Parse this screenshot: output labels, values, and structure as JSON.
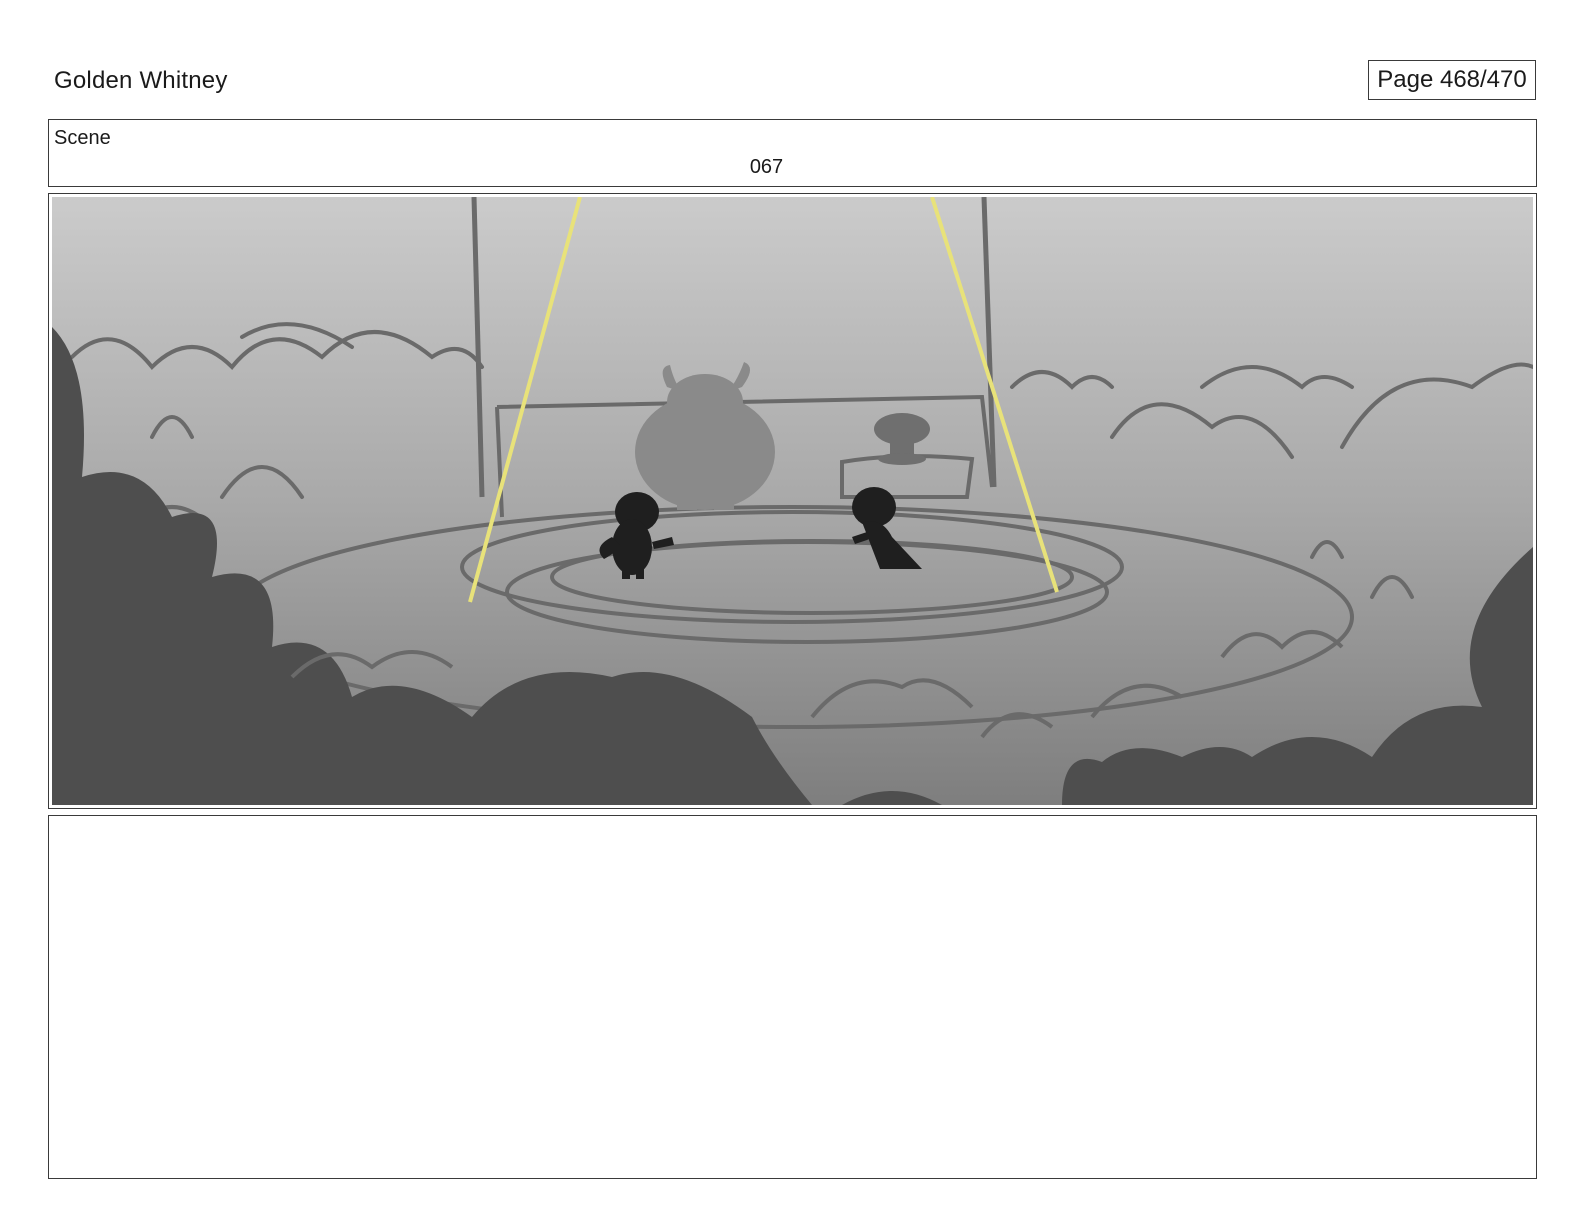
{
  "header": {
    "project_title": "Golden Whitney",
    "page_indicator": "Page 468/470"
  },
  "scene": {
    "label": "Scene",
    "number": "067"
  },
  "panel": {
    "image_subject": "storyboard sketch: two small dark creature silhouettes on a round stage, a large horned silhouette behind them, a small trophy figure on a pedestal, two yellow spotlight beams from above, and a crowd of rounded bush shapes in the foreground",
    "colors": {
      "sky_top": "#c9c9c9",
      "ground": "#8f8f8f",
      "foreground_bush": "#4e4e4e",
      "sketch_line": "#6a6a6a",
      "spotlight": "#e8e27a",
      "character": "#1f1f1f"
    }
  },
  "notes": {
    "text": ""
  }
}
